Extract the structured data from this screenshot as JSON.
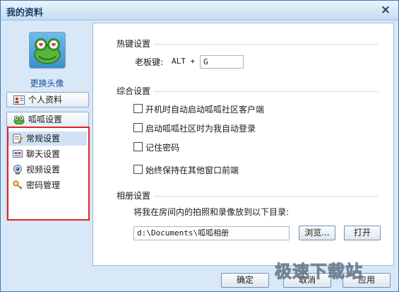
{
  "window": {
    "title": "我的资料",
    "close_glyph": "×"
  },
  "sidebar": {
    "change_avatar": "更换头像",
    "nav": [
      {
        "label": "个人资料",
        "icon": "profile-card-icon"
      },
      {
        "label": "呱呱设置",
        "icon": "frog-icon"
      }
    ],
    "subitems": [
      {
        "label": "常规设置",
        "icon": "general-settings-icon",
        "selected": true
      },
      {
        "label": "聊天设置",
        "icon": "chat-settings-icon",
        "selected": false
      },
      {
        "label": "视频设置",
        "icon": "video-settings-icon",
        "selected": false
      },
      {
        "label": "密码管理",
        "icon": "key-icon",
        "selected": false
      }
    ]
  },
  "hotkey": {
    "section": "热键设置",
    "boss_key_label": "老板键:",
    "modifier": "ALT +",
    "key_value": "G"
  },
  "general": {
    "section": "综合设置",
    "options": [
      {
        "label": "开机时自动启动呱呱社区客户端",
        "checked": false
      },
      {
        "label": "启动呱呱社区时为我自动登录",
        "checked": false
      },
      {
        "label": "记住密码",
        "checked": false
      },
      {
        "label": "始终保持在其他窗口前端",
        "checked": false
      }
    ]
  },
  "album": {
    "section": "相册设置",
    "description": "将我在房间内的拍照和录像放到以下目录:",
    "path": "d:\\Documents\\呱呱相册",
    "browse_label": "浏览...",
    "open_label": "打开"
  },
  "footer": {
    "ok_label": "确定",
    "cancel_label": "取消",
    "apply_label": "应用"
  },
  "watermark": "极速下载站",
  "colors": {
    "highlight_border": "#e02424",
    "frame_background": "#d9e8f7",
    "title_text": "#1b3b63",
    "link": "#1a4fa0"
  }
}
